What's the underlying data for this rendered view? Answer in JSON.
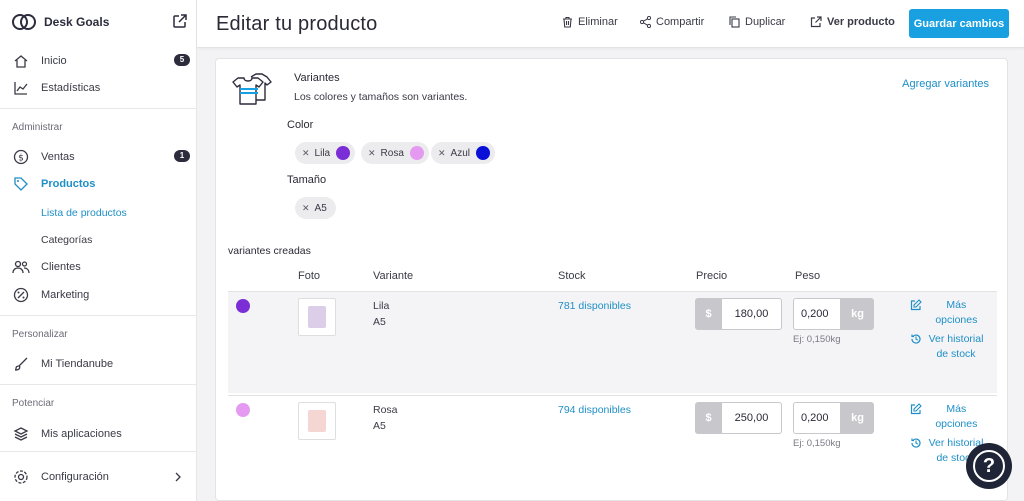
{
  "sidebar": {
    "brand": "Desk Goals",
    "items": {
      "inicio": {
        "label": "Inicio",
        "badge": "5"
      },
      "estadisticas": {
        "label": "Estadísticas"
      },
      "ventas": {
        "label": "Ventas",
        "badge": "1"
      },
      "productos": {
        "label": "Productos"
      },
      "lista": {
        "label": "Lista de productos"
      },
      "categorias": {
        "label": "Categorías"
      },
      "clientes": {
        "label": "Clientes"
      },
      "marketing": {
        "label": "Marketing"
      },
      "tiendanube": {
        "label": "Mi Tiendanube"
      },
      "aplicaciones": {
        "label": "Mis aplicaciones"
      },
      "configuracion": {
        "label": "Configuración"
      }
    },
    "sections": {
      "administrar": "Administrar",
      "personalizar": "Personalizar",
      "potenciar": "Potenciar"
    }
  },
  "header": {
    "title": "Editar tu producto",
    "eliminar": "Eliminar",
    "compartir": "Compartir",
    "duplicar": "Duplicar",
    "ver_producto": "Ver producto",
    "guardar": "Guardar cambios"
  },
  "variants": {
    "title": "Variantes",
    "description": "Los colores y tamaños son variantes.",
    "add_label": "Agregar variantes",
    "color_label": "Color",
    "size_label": "Tamaño",
    "colors": [
      {
        "name": "Lila",
        "color": "#7b2ed6"
      },
      {
        "name": "Rosa",
        "color": "#e49af0"
      },
      {
        "name": "Azul",
        "color": "#0a10d8"
      }
    ],
    "sizes": [
      {
        "name": "A5"
      }
    ],
    "created_label": "variantes creadas",
    "columns": {
      "foto": "Foto",
      "variante": "Variante",
      "stock": "Stock",
      "precio": "Precio",
      "peso": "Peso"
    },
    "rows": [
      {
        "color": "#7b2ed6",
        "thumb": "#dccde8",
        "name": "Lila",
        "size": "A5",
        "stock": "781 disponibles",
        "currency": "$",
        "price": "180,00",
        "weight": "0,200",
        "unit": "kg",
        "hint": "Ej: 0,150kg",
        "more": "Más opciones",
        "history": "Ver historial de stock"
      },
      {
        "color": "#e49af0",
        "thumb": "#f6d6d2",
        "name": "Rosa",
        "size": "A5",
        "stock": "794 disponibles",
        "currency": "$",
        "price": "250,00",
        "weight": "0,200",
        "unit": "kg",
        "hint": "Ej: 0,150kg",
        "more": "Más opciones",
        "history": "Ver historial de stock"
      }
    ]
  },
  "help": {
    "label": "?"
  }
}
